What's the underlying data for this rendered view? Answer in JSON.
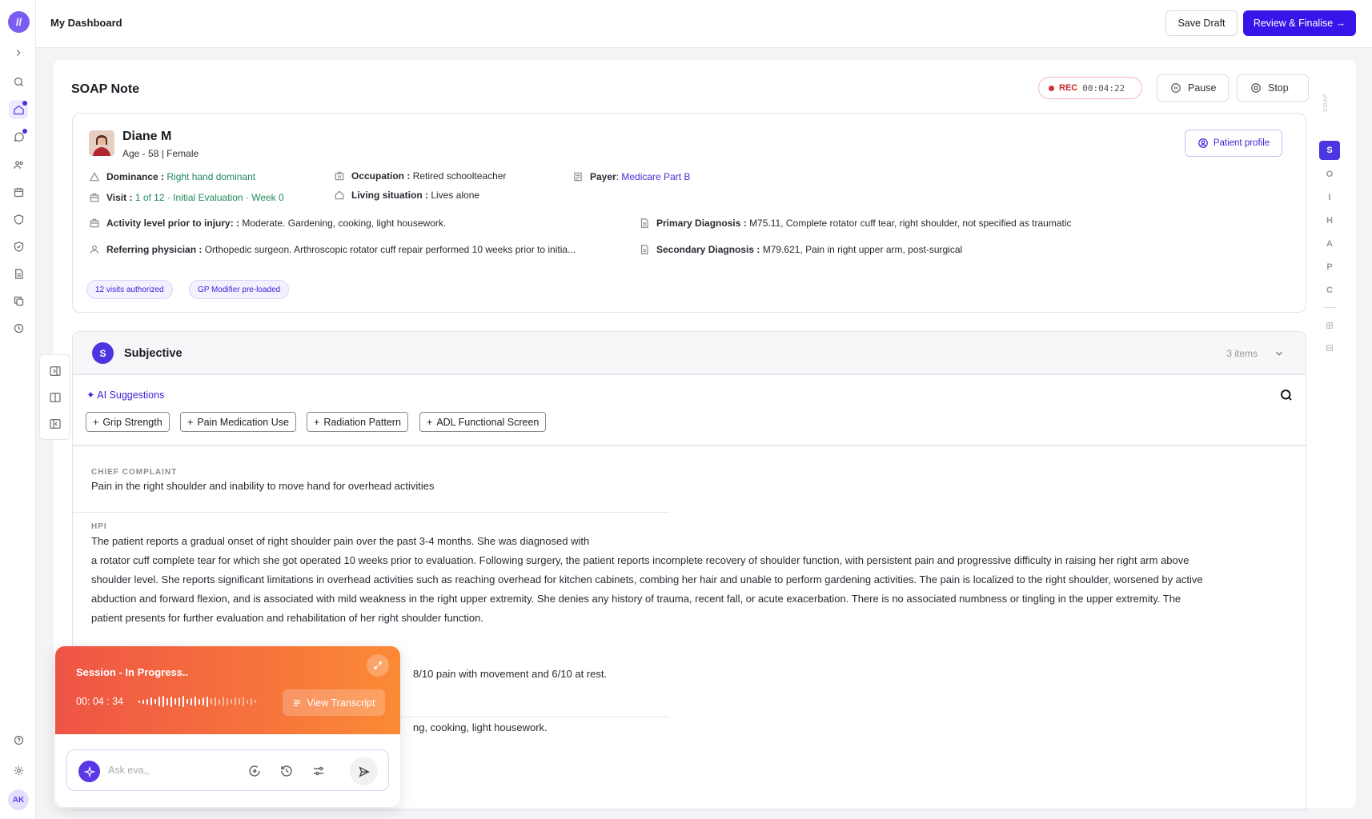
{
  "app": {
    "logo": "//",
    "user_initials": "AK"
  },
  "header": {
    "title": "My Dashboard",
    "save_draft": "Save Draft",
    "review": "Review & Finalise →"
  },
  "soap": {
    "title": "SOAP Note",
    "rec_label": "REC",
    "rec_time": "00:04:22",
    "pause": "Pause",
    "stop": "Stop"
  },
  "patient": {
    "name": "Diane M",
    "meta": "Age - 58 | Female",
    "profile_button": "Patient profile",
    "dominance_label": "Dominance :",
    "dominance_value": "Right hand dominant",
    "visit_label": "Visit :",
    "visit_value": "1 of 12 · Initial Evaluation · Week 0",
    "occupation_label": "Occupation :",
    "occupation_value": "Retired schoolteacher",
    "living_label": "Living situation :",
    "living_value": "Lives alone",
    "payer_label": "Payer",
    "payer_value": ": Medicare Part B",
    "activity_label": "Activity level prior to injury: :",
    "activity_value": "Moderate. Gardening, cooking, light housework.",
    "referring_label": "Referring physician :",
    "referring_value": "Orthopedic surgeon. Arthroscopic rotator cuff repair performed 10 weeks prior to initia...",
    "primary_label": "Primary Diagnosis :",
    "primary_value": "M75.11, Complete rotator cuff tear, right shoulder, not specified as traumatic",
    "secondary_label": "Secondary Diagnosis :",
    "secondary_value": "M79.621, Pain in right upper arm, post-surgical",
    "chips": [
      "12 visits authorized",
      "GP Modifier pre-loaded"
    ]
  },
  "subjective": {
    "badge": "S",
    "title": "Subjective",
    "count": "3 items",
    "ai_label": "✦ AI Suggestions",
    "suggestions": [
      "Grip Strength",
      "Pain Medication Use",
      "Radiation Pattern",
      "ADL Functional Screen"
    ],
    "cc_label": "CHIEF COMPLAINT",
    "cc_text": "Pain in the right shoulder and inability to move hand for overhead activities",
    "hpi_label": "HPI",
    "hpi_lines": [
      "The patient reports a gradual onset of right shoulder pain over the past 3-4 months. She was diagnosed with",
      "a rotator cuff complete tear for which she got operated 10 weeks prior to evaluation. Following surgery, the patient reports incomplete recovery of shoulder function, with persistent pain and progressive difficulty in raising her right arm above",
      "shoulder level. She reports significant limitations in overhead activities such as reaching overhead for kitchen cabinets, combing her hair and unable to perform gardening activities. The pain is localized to the right shoulder, worsened by active",
      "abduction and forward flexion, and is associated with mild weakness in the right upper extremity. She denies any history of trauma, recent fall, or acute exacerbation. There is no associated numbness or tingling in the upper extremity. The",
      "patient presents for further evaluation and rehabilitation of her right shoulder function."
    ],
    "pain_fragment": "8/10 pain with movement and 6/10 at rest.",
    "activity_fragment": "ng, cooking, light housework."
  },
  "soap_nav": {
    "label": "SOAP",
    "letters": [
      "S",
      "O",
      "I",
      "H",
      "A",
      "P",
      "C"
    ]
  },
  "session": {
    "title": "Session - In Progress..",
    "time": "00: 04 : 34",
    "view_transcript": "View Transcript",
    "ask_placeholder": "Ask eva,,"
  }
}
